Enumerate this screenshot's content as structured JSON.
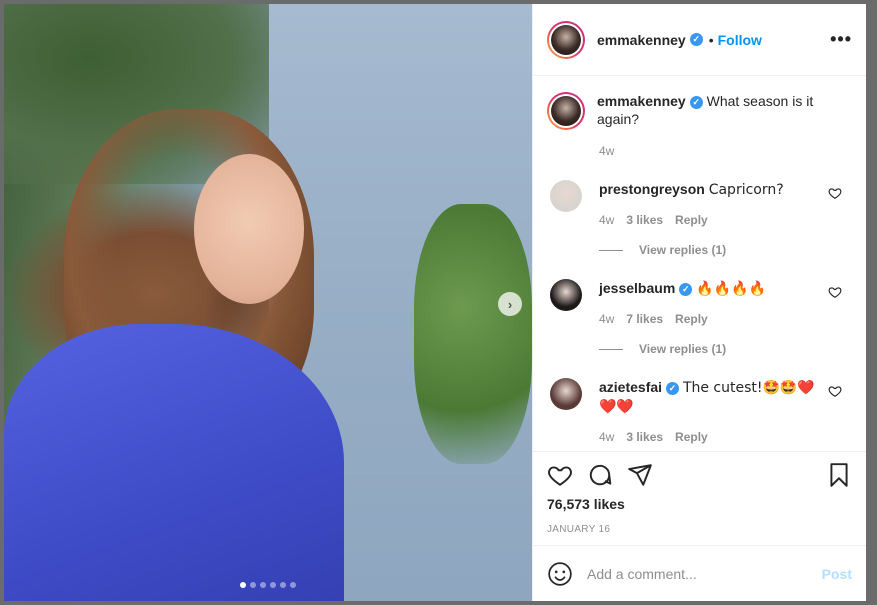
{
  "post": {
    "username": "emmakenney",
    "follow_label": "Follow",
    "bullet": "•",
    "more_label": "•••",
    "caption": "What season is it again?",
    "caption_age": "4w",
    "likes": "76,573 likes",
    "date": "JANUARY 16",
    "carousel_count": 6,
    "carousel_index": 0
  },
  "comments": [
    {
      "username": "prestongreyson",
      "verified": false,
      "text": "Capricorn?",
      "age": "4w",
      "likes": "3 likes",
      "reply_label": "Reply",
      "view_replies": "View replies (1)",
      "avatar_color": "#d9d4cf"
    },
    {
      "username": "jesselbaum",
      "verified": true,
      "text": "🔥🔥🔥🔥",
      "age": "4w",
      "likes": "7 likes",
      "reply_label": "Reply",
      "view_replies": "View replies (1)",
      "avatar_color": "#1e1a19"
    },
    {
      "username": "azietesfai",
      "verified": true,
      "text": "The cutest!🤩🤩❤️❤️❤️",
      "age": "4w",
      "likes": "3 likes",
      "reply_label": "Reply",
      "avatar_color": "#5a3a36"
    }
  ],
  "composer": {
    "placeholder": "Add a comment...",
    "post_label": "Post"
  },
  "colors": {
    "accent": "#0095f6",
    "verified": "#3897f0",
    "muted": "#8e8e8e",
    "post_disabled": "#b2dffc"
  },
  "icons": [
    "chevron-right-icon",
    "more-icon",
    "verified-icon",
    "heart-icon",
    "comment-icon",
    "share-icon",
    "bookmark-icon",
    "emoji-icon"
  ]
}
